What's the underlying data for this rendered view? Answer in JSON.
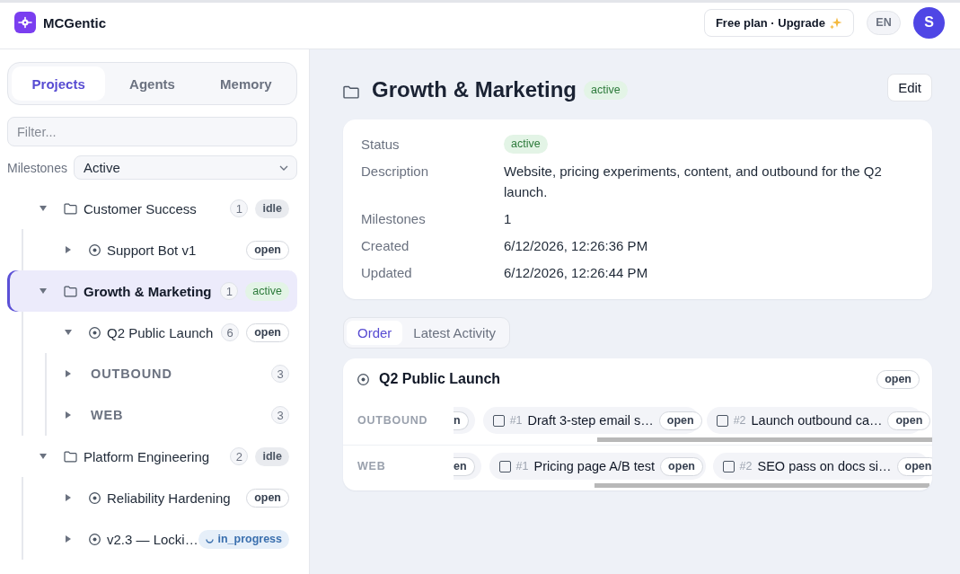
{
  "app": {
    "name": "MCGentic"
  },
  "topbar": {
    "plan_button": "Free plan · Upgrade",
    "language": "EN",
    "avatar_initial": "S"
  },
  "sidebar": {
    "tabs": [
      {
        "label": "Projects",
        "selected": true
      },
      {
        "label": "Agents",
        "selected": false
      },
      {
        "label": "Memory",
        "selected": false
      }
    ],
    "filter": {
      "placeholder": "Filter..."
    },
    "milestones_filter": {
      "label": "Milestones",
      "value": "Active"
    },
    "tree": [
      {
        "kind": "project",
        "name": "Customer Success",
        "count": "1",
        "status": {
          "text": "idle",
          "kind": "neutral"
        },
        "expanded": true,
        "selected": false,
        "children": [
          {
            "kind": "milestone",
            "name": "Support Bot v1",
            "status": {
              "text": "open",
              "kind": "outline"
            },
            "expanded": false,
            "selected": false
          }
        ]
      },
      {
        "kind": "project",
        "name": "Growth & Marketing",
        "count": "1",
        "status": {
          "text": "active",
          "kind": "success"
        },
        "expanded": true,
        "selected": true,
        "children": [
          {
            "kind": "milestone",
            "name": "Q2 Public Launch",
            "count": "6",
            "status": {
              "text": "open",
              "kind": "outline"
            },
            "expanded": true,
            "selected": false,
            "children": [
              {
                "kind": "group",
                "name": "OUTBOUND",
                "count": "3",
                "expanded": false,
                "selected": false
              },
              {
                "kind": "group",
                "name": "WEB",
                "count": "3",
                "expanded": false,
                "selected": false
              }
            ]
          }
        ]
      },
      {
        "kind": "project",
        "name": "Platform Engineering",
        "count": "2",
        "status": {
          "text": "idle",
          "kind": "neutral"
        },
        "expanded": true,
        "selected": false,
        "children": [
          {
            "kind": "milestone",
            "name": "Reliability Hardening",
            "status": {
              "text": "open",
              "kind": "outline"
            },
            "expanded": false,
            "selected": false
          },
          {
            "kind": "milestone",
            "name": "v2.3 — Locki…",
            "status": {
              "text": "in_progress",
              "kind": "progress"
            },
            "expanded": false,
            "selected": false
          }
        ]
      }
    ]
  },
  "project": {
    "title": "Growth & Marketing",
    "status": {
      "text": "active",
      "kind": "success"
    },
    "edit_button": "Edit",
    "details": [
      {
        "kind": "badge",
        "label": "Status",
        "status": {
          "text": "active",
          "kind": "success"
        }
      },
      {
        "kind": "text",
        "label": "Description",
        "value": "Website, pricing experiments, content, and outbound for the Q2 launch."
      },
      {
        "kind": "text",
        "label": "Milestones",
        "value": "1"
      },
      {
        "kind": "text",
        "label": "Created",
        "value": "6/12/2026, 12:26:36 PM"
      },
      {
        "kind": "text",
        "label": "Updated",
        "value": "6/12/2026, 12:26:44 PM"
      }
    ]
  },
  "view_tabs": [
    {
      "label": "Order",
      "selected": true
    },
    {
      "label": "Latest Activity",
      "selected": false
    }
  ],
  "milestone_card": {
    "title": "Q2 Public Launch",
    "status": {
      "text": "open",
      "kind": "outline"
    },
    "groups": [
      {
        "label": "OUTBOUND",
        "tasks": [
          {
            "kind": "clipped",
            "status": {
              "text": "n",
              "kind": "outline"
            }
          },
          {
            "kind": "task",
            "number": "#1",
            "title": "Draft 3-step email s…",
            "checked": false,
            "status": {
              "text": "open",
              "kind": "outline"
            }
          },
          {
            "kind": "task",
            "number": "#2",
            "title": "Launch outbound ca…",
            "checked": false,
            "status": {
              "text": "open",
              "kind": "outline"
            }
          }
        ]
      },
      {
        "label": "WEB",
        "tasks": [
          {
            "kind": "clipped",
            "status": {
              "text": "en",
              "kind": "outline"
            }
          },
          {
            "kind": "task",
            "number": "#1",
            "title": "Pricing page A/B test",
            "checked": false,
            "status": {
              "text": "open",
              "kind": "outline"
            }
          },
          {
            "kind": "task",
            "number": "#2",
            "title": "SEO pass on docs si…",
            "checked": false,
            "status": {
              "text": "open",
              "kind": "outline"
            }
          }
        ]
      }
    ]
  }
}
